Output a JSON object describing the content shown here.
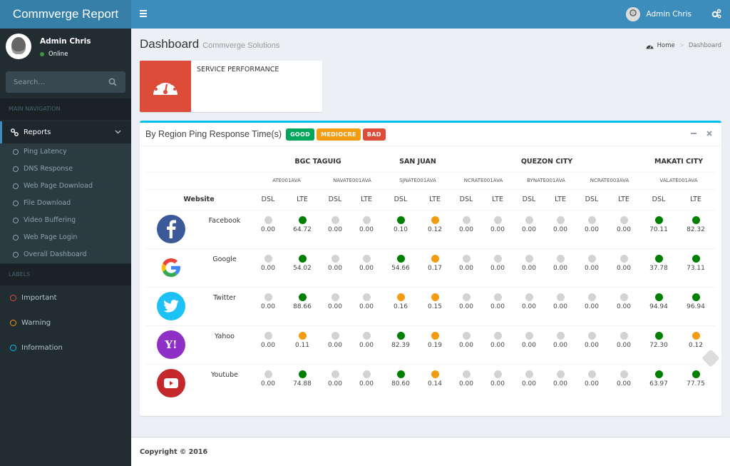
{
  "app": {
    "title": "Commverge Report"
  },
  "navbar": {
    "user_name": "Admin Chris",
    "menu_icon": "hamburger-icon",
    "settings_icon": "gears-icon"
  },
  "sidebar": {
    "user": {
      "name": "Admin Chris",
      "status": "Online"
    },
    "search": {
      "placeholder": "Search..."
    },
    "main_header": "MAIN NAVIGATION",
    "reports": {
      "label": "Reports",
      "icon": "link-icon"
    },
    "submenu": [
      {
        "label": "Ping Latency"
      },
      {
        "label": "DNS Response"
      },
      {
        "label": " Web Page Download"
      },
      {
        "label": "File Download"
      },
      {
        "label": "Video Buffering"
      },
      {
        "label": "Web Page Login"
      },
      {
        "label": "Overall Dashboard"
      }
    ],
    "labels_header": "LABELS",
    "labels": [
      {
        "label": "Important",
        "color": "#dd4b39"
      },
      {
        "label": "Warning",
        "color": "#f39c12"
      },
      {
        "label": "Information",
        "color": "#00c0ef"
      }
    ]
  },
  "page": {
    "title": "Dashboard",
    "subtitle": "Commverge Solutions",
    "breadcrumb": {
      "home": "Home",
      "current": "Dashboard"
    }
  },
  "info_box": {
    "label": "SERVICE PERFORMANCE",
    "icon": "dashboard-gauge-icon",
    "color": "#dd4b39"
  },
  "panel": {
    "title": "By Region Ping Response Time(s)",
    "legend": [
      {
        "label": "GOOD",
        "color": "#00a65a"
      },
      {
        "label": "MEDIOCRE",
        "color": "#f39c12"
      },
      {
        "label": "BAD",
        "color": "#dd4b39"
      }
    ],
    "website_header": "Website",
    "regions": [
      {
        "name": "BGC TAGUIG",
        "nodes": [
          "ATE001AVA",
          "NAVATE001AVA"
        ]
      },
      {
        "name": "SAN JUAN",
        "nodes": [
          "SJNATE001AVA"
        ]
      },
      {
        "name": "QUEZON CITY",
        "nodes": [
          "NCRATE001AVA",
          "BYNATE001AVA",
          "NCRATE003AVA"
        ]
      },
      {
        "name": "MAKATI CITY",
        "nodes": [
          "VALATE001AVA"
        ]
      }
    ],
    "types": [
      "DSL",
      "LTE"
    ],
    "status_colors": {
      "good": "#008000",
      "mediocre": "#f39c12",
      "none": "#d3d3d3"
    },
    "rows": [
      {
        "site": "Facebook",
        "logo": "facebook-logo-icon",
        "values": [
          "0.00",
          "64.72",
          "0.00",
          "0.00",
          "0.10",
          "0.12",
          "0.00",
          "0.00",
          "0.00",
          "0.00",
          "0.00",
          "0.00",
          "70.11",
          "82.32"
        ],
        "status": [
          "none",
          "good",
          "none",
          "none",
          "good",
          "mediocre",
          "none",
          "none",
          "none",
          "none",
          "none",
          "none",
          "good",
          "good"
        ]
      },
      {
        "site": "Google",
        "logo": "google-logo-icon",
        "values": [
          "0.00",
          "54.02",
          "0.00",
          "0.00",
          "54.66",
          "0.17",
          "0.00",
          "0.00",
          "0.00",
          "0.00",
          "0.00",
          "0.00",
          "37.78",
          "73.11"
        ],
        "status": [
          "none",
          "good",
          "none",
          "none",
          "good",
          "mediocre",
          "none",
          "none",
          "none",
          "none",
          "none",
          "none",
          "good",
          "good"
        ]
      },
      {
        "site": "Twitter",
        "logo": "twitter-logo-icon",
        "values": [
          "0.00",
          "88.66",
          "0.00",
          "0.00",
          "0.16",
          "0.15",
          "0.00",
          "0.00",
          "0.00",
          "0.00",
          "0.00",
          "0.00",
          "94.94",
          "96.94"
        ],
        "status": [
          "none",
          "good",
          "none",
          "none",
          "mediocre",
          "mediocre",
          "none",
          "none",
          "none",
          "none",
          "none",
          "none",
          "good",
          "good"
        ]
      },
      {
        "site": "Yahoo",
        "logo": "yahoo-logo-icon",
        "values": [
          "0.00",
          "0.11",
          "0.00",
          "0.00",
          "82.39",
          "0.19",
          "0.00",
          "0.00",
          "0.00",
          "0.00",
          "0.00",
          "0.00",
          "72.30",
          "0.12"
        ],
        "status": [
          "none",
          "mediocre",
          "none",
          "none",
          "good",
          "mediocre",
          "none",
          "none",
          "none",
          "none",
          "none",
          "none",
          "good",
          "mediocre"
        ]
      },
      {
        "site": "Youtube",
        "logo": "youtube-logo-icon",
        "values": [
          "0.00",
          "74.88",
          "0.00",
          "0.00",
          "80.60",
          "0.14",
          "0.00",
          "0.00",
          "0.00",
          "0.00",
          "0.00",
          "0.00",
          "63.97",
          "77.75"
        ],
        "status": [
          "none",
          "good",
          "none",
          "none",
          "good",
          "mediocre",
          "none",
          "none",
          "none",
          "none",
          "none",
          "none",
          "good",
          "good"
        ]
      }
    ]
  },
  "footer": {
    "copyright": "Copyright © 2016"
  }
}
